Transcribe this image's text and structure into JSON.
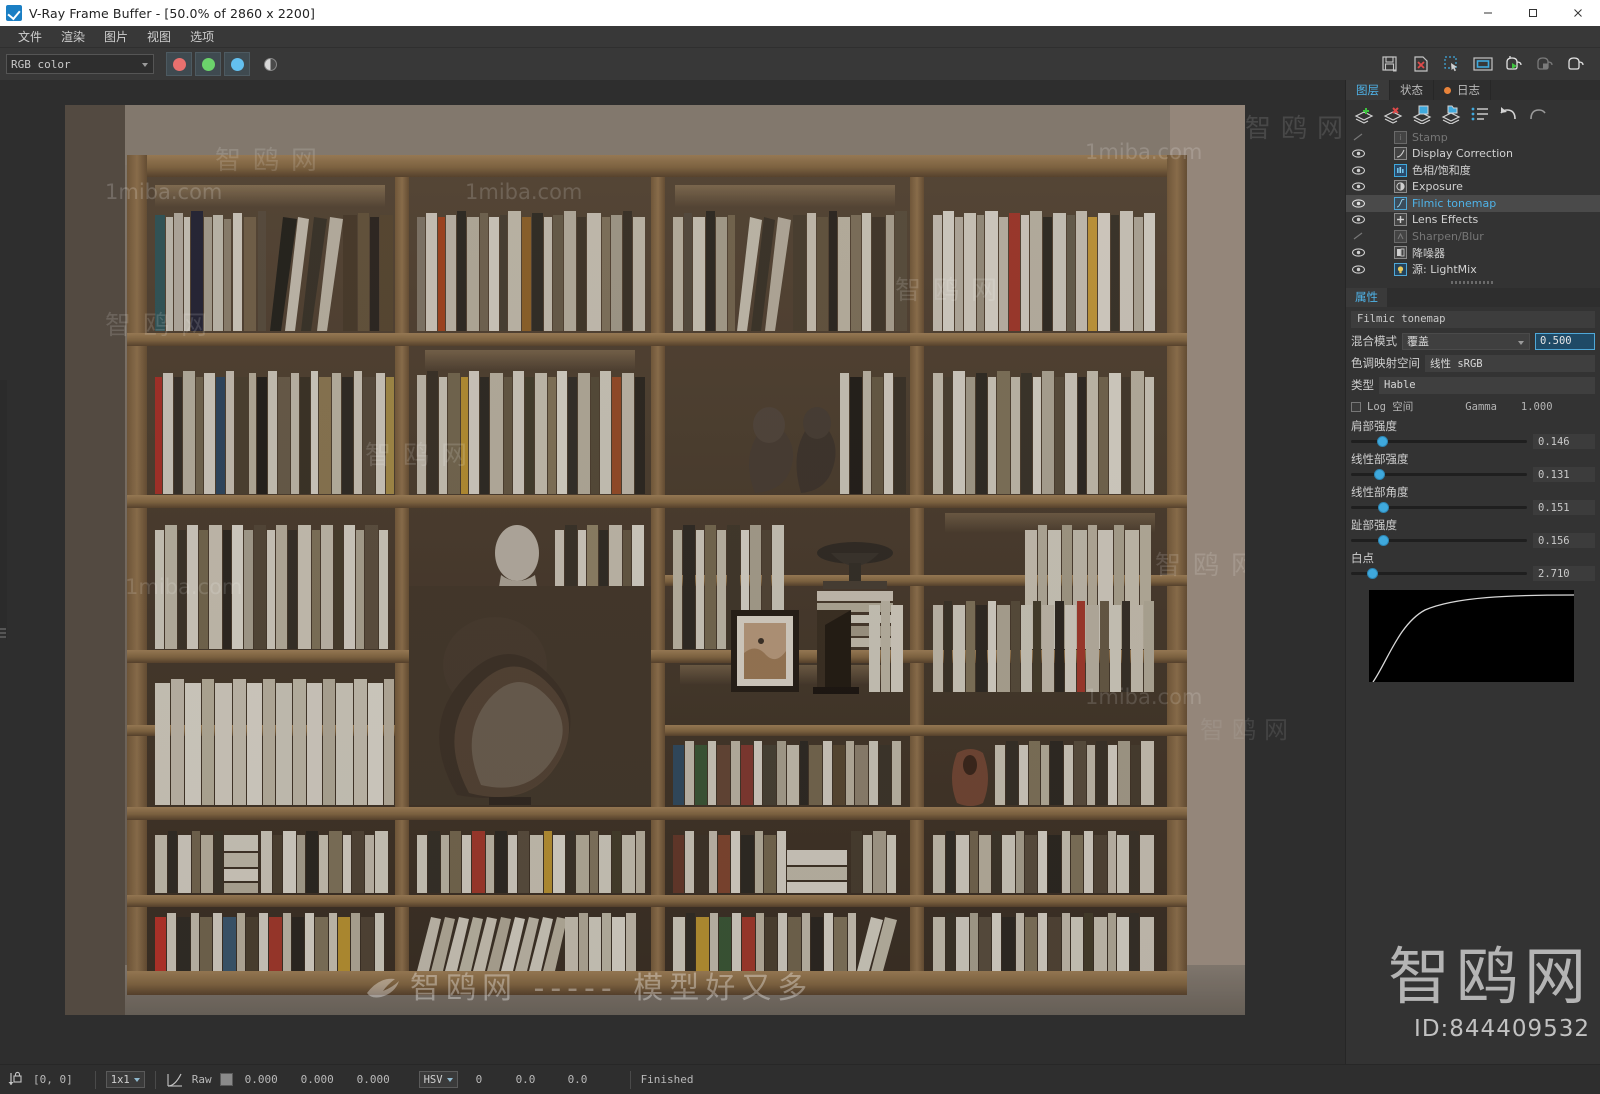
{
  "window": {
    "title": "V-Ray Frame Buffer - [50.0% of 2860 x 2200]",
    "icon": "vray-logo-icon",
    "minimize": "–",
    "maximize": "□",
    "close": "✕"
  },
  "menubar": {
    "items": [
      {
        "label": "文件",
        "name": "menu-file"
      },
      {
        "label": "渲染",
        "name": "menu-render"
      },
      {
        "label": "图片",
        "name": "menu-image"
      },
      {
        "label": "视图",
        "name": "menu-view"
      },
      {
        "label": "选项",
        "name": "menu-options"
      }
    ]
  },
  "toolbar": {
    "channel_select": "RGB color",
    "channels": [
      {
        "name": "red-channel-button",
        "color": "#e8706e"
      },
      {
        "name": "green-channel-button",
        "color": "#6bd36b"
      },
      {
        "name": "blue-channel-button",
        "color": "#63c0f0"
      }
    ],
    "mono_button": "monochrome-toggle",
    "right_icons": [
      {
        "name": "save-image-icon",
        "title": "Save image"
      },
      {
        "name": "clear-image-icon",
        "title": "Clear image"
      },
      {
        "name": "region-render-icon",
        "title": "Render region"
      },
      {
        "name": "view-fit-icon",
        "title": "Fit view"
      },
      {
        "name": "render-start-icon",
        "title": "Start render"
      },
      {
        "name": "render-stop-icon",
        "title": "Stop render"
      },
      {
        "name": "render-last-icon",
        "title": "Render last"
      }
    ]
  },
  "right_panel": {
    "tabs": [
      {
        "label": "图层",
        "name": "tab-layers",
        "active": true
      },
      {
        "label": "状态",
        "name": "tab-stats",
        "active": false
      },
      {
        "label": "日志",
        "name": "tab-log",
        "active": false,
        "led": "#e8833a"
      }
    ],
    "layer_toolbar": [
      {
        "name": "add-layer-icon"
      },
      {
        "name": "delete-layer-icon"
      },
      {
        "name": "save-layer-icon"
      },
      {
        "name": "load-layer-icon"
      },
      {
        "name": "layer-list-icon"
      },
      {
        "name": "undo-icon"
      },
      {
        "name": "redo-icon"
      }
    ],
    "layers": [
      {
        "label": "Stamp",
        "icon": "stamp-icon",
        "visible": false,
        "dim": true,
        "selected": false
      },
      {
        "label": "Display Correction",
        "icon": "curve-icon",
        "visible": true,
        "dim": false,
        "selected": false
      },
      {
        "label": "色相/饱和度",
        "icon": "hue-sat-icon",
        "visible": true,
        "dim": false,
        "selected": false
      },
      {
        "label": "Exposure",
        "icon": "exposure-icon",
        "visible": true,
        "dim": false,
        "selected": false
      },
      {
        "label": "Filmic tonemap",
        "icon": "filmic-icon",
        "visible": true,
        "dim": false,
        "selected": true
      },
      {
        "label": "Lens Effects",
        "icon": "lens-effects-icon",
        "visible": true,
        "dim": false,
        "selected": false
      },
      {
        "label": "Sharpen/Blur",
        "icon": "sharpen-blur-icon",
        "visible": false,
        "dim": true,
        "selected": false
      },
      {
        "label": "降噪器",
        "icon": "denoiser-icon",
        "visible": true,
        "dim": false,
        "selected": false
      },
      {
        "label": "源: LightMix",
        "icon": "lightmix-icon",
        "visible": true,
        "dim": false,
        "selected": false
      }
    ]
  },
  "properties": {
    "tab_label": "属性",
    "title": "Filmic tonemap",
    "blend_mode_label": "混合模式",
    "blend_mode_value": "覆盖",
    "blend_amount": "0.500",
    "tonemap_space_label": "色调映射空间",
    "tonemap_space_value": "线性 sRGB",
    "type_label": "类型",
    "type_value": "Hable",
    "log_space_label": "Log 空间",
    "gamma_label": "Gamma",
    "gamma_value": "1.000",
    "sliders": [
      {
        "label": "肩部强度",
        "value": "0.146",
        "pct": 14.6
      },
      {
        "label": "线性部强度",
        "value": "0.131",
        "pct": 13.1
      },
      {
        "label": "线性部角度",
        "value": "0.151",
        "pct": 15.1
      },
      {
        "label": "趾部强度",
        "value": "0.156",
        "pct": 15.6
      },
      {
        "label": "白点",
        "value": "2.710",
        "pct": 9.0
      }
    ],
    "curve_name": "tone-curve-preview"
  },
  "statusbar": {
    "pin_icon": "pin-lock-icon",
    "coords": "[0,  0]",
    "sample_size": "1x1",
    "curve_icon": "pixel-curve-icon",
    "raw_label": "Raw",
    "rgb_values": [
      "0.000",
      "0.000",
      "0.000"
    ],
    "color_mode": "HSV",
    "hsv_values": [
      "0",
      "0.0",
      "0.0"
    ],
    "status": "Finished"
  },
  "watermarks": {
    "brand": "智鸥网",
    "id": "ID:844409532",
    "site": "1miba.com",
    "tagline": "智鸥网 ----- 模型好又多",
    "brand_dash": "智鸥网"
  }
}
